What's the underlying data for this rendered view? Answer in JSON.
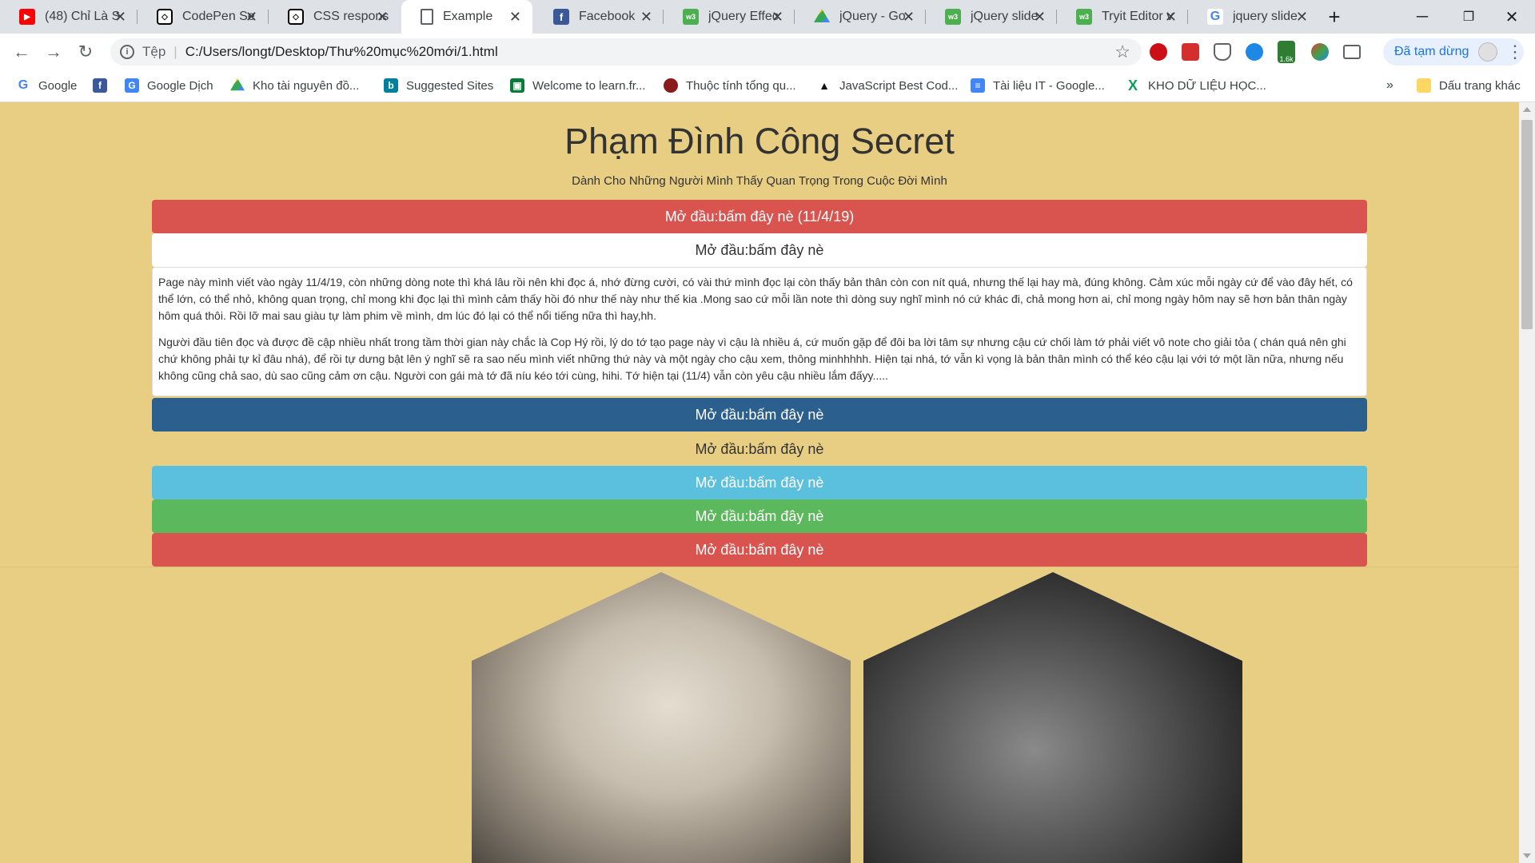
{
  "browser": {
    "tabs": [
      {
        "title": "(48) Chỉ Là S",
        "icon": "youtube-icon",
        "active": false
      },
      {
        "title": "CodePen Se",
        "icon": "codepen-icon",
        "active": false
      },
      {
        "title": "CSS respons",
        "icon": "codepen-icon",
        "active": false
      },
      {
        "title": "Example",
        "icon": "document-icon",
        "active": true
      },
      {
        "title": "Facebook",
        "icon": "facebook-icon",
        "active": false
      },
      {
        "title": "jQuery Effec",
        "icon": "w3schools-icon",
        "active": false
      },
      {
        "title": "jQuery - Go",
        "icon": "google-drive-icon",
        "active": false
      },
      {
        "title": "jQuery slide",
        "icon": "w3schools-icon",
        "active": false
      },
      {
        "title": "Tryit Editor v",
        "icon": "w3schools-icon",
        "active": false
      },
      {
        "title": "jquery slide",
        "icon": "google-icon",
        "active": false
      }
    ],
    "address": {
      "scheme_label": "Tệp",
      "url": "C:/Users/longt/Desktop/Thư%20mục%20mới/1.html"
    },
    "extension_badge": "1.6k",
    "profile_status": "Đã tạm dừng",
    "bookmarks": [
      {
        "label": "Google",
        "icon": "google-icon"
      },
      {
        "label": "",
        "icon": "facebook-icon"
      },
      {
        "label": "Google Dịch",
        "icon": "google-translate-icon"
      },
      {
        "label": "Kho tài nguyên đồ...",
        "icon": "google-drive-icon"
      },
      {
        "label": "Suggested Sites",
        "icon": "bing-icon"
      },
      {
        "label": "Welcome to learn.fr...",
        "icon": "learn-icon"
      },
      {
        "label": "Thuộc tính tổng qu...",
        "icon": "site-icon"
      },
      {
        "label": "JavaScript Best Cod...",
        "icon": "javascript-icon"
      },
      {
        "label": "Tài liệu IT - Google...",
        "icon": "google-docs-icon"
      },
      {
        "label": "KHO DỮ LIỆU HỌC...",
        "icon": "x-icon"
      }
    ],
    "bookmarks_overflow": "»",
    "other_bookmarks": "Dấu trang khác"
  },
  "page": {
    "title": "Phạm Đình Công Secret",
    "subtitle": "Dành Cho Những Người Mình Thấy Quan Trọng Trong Cuộc Đời Mình",
    "accordion": [
      {
        "label": "Mở đầu:bấm đây nè (11/4/19)",
        "style": "red"
      },
      {
        "label": "Mở đầu:bấm đây nè",
        "style": "white"
      },
      {
        "label": "Mở đầu:bấm đây nè",
        "style": "blue"
      },
      {
        "label": "Mở đầu:bấm đây nè",
        "style": "plain"
      },
      {
        "label": "Mở đầu:bấm đây nè",
        "style": "cyan"
      },
      {
        "label": "Mở đầu:bấm đây nè",
        "style": "green"
      },
      {
        "label": "Mở đầu:bấm đây nè",
        "style": "red"
      }
    ],
    "panel": {
      "paragraph_1": "Page này mình viết vào ngày 11/4/19, còn những dòng note thì khá lâu rồi nên khi đọc á, nhớ đừng cười, có vài thứ mình đọc lại còn thấy bản thân còn con nít quá, nhưng thế lại hay mà, đúng không. Cảm xúc mỗi ngày cứ để vào đây hết, có thể lớn, có thể nhỏ, không quan trọng, chỉ mong khi đọc lại thì mình cảm thấy hồi đó như thế này như thế kia .Mong sao cứ mỗi lần note thì dòng suy nghĩ mình nó cứ khác đi, chả mong hơn ai, chỉ mong ngày hôm nay sẽ hơn bản thân ngày hôm quá thôi. Rồi lỡ mai sau giàu tự làm phim về mình, dm lúc đó lại có thể nổi tiếng nữa thì hay,hh.",
      "paragraph_2": "Người đầu tiên đọc và được đề cập nhiều nhất trong tầm thời gian này chắc là Cop Hý rồi, lý do tớ tạo page này vì cậu là nhiều á, cứ muốn gặp để đôi ba lời tâm sự nhưng cậu cứ chối làm tớ phải viết vô note cho giải tỏa ( chán quá nên ghi chứ không phải tự kỉ đâu nhá), để rồi tự dưng bật lên ý nghĩ sẽ ra sao nếu mình viết những thứ này và một ngày cho cậu xem, thông minhhhhh. Hiện tại nhá, tớ vẫn kì vọng là bản thân mình có thể kéo cậu lại với tớ một lần nữa, nhưng nếu không cũng chả sao, dù sao cũng cảm ơn cậu. Người con gái mà tớ đã níu kéo tới cùng, hihi. Tớ hiện tại (11/4) vẫn còn yêu cậu nhiều lắm đấyy....."
    },
    "gallery": [
      {
        "image": "portrait-woman",
        "style": "sepia"
      },
      {
        "image": "portrait-child-pointing",
        "style": "black-and-white"
      }
    ],
    "colors": {
      "page_background": "#e8ce82",
      "red": "#d9534f",
      "blue": "#2b5f8e",
      "cyan": "#5bc0de",
      "green": "#5cb85c"
    }
  }
}
